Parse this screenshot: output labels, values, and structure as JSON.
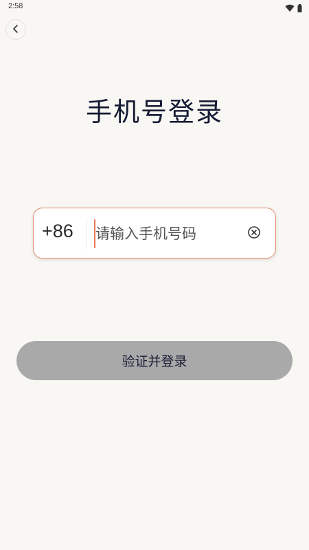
{
  "status_bar": {
    "time": "2:58",
    "icons": [
      "wifi-icon",
      "battery-icon"
    ]
  },
  "header": {
    "back_icon": "chevron-left-icon"
  },
  "page": {
    "title": "手机号登录"
  },
  "phone_form": {
    "country_code": "+86",
    "phone_value": "",
    "phone_placeholder": "请输入手机号码",
    "clear_icon": "clear-circle-icon"
  },
  "actions": {
    "submit_label": "验证并登录"
  },
  "colors": {
    "background": "#f8f7f3",
    "input_border": "#e48a70",
    "caret": "#e07a55",
    "button_disabled": "#a9a9a9",
    "title_text": "#141a33"
  }
}
